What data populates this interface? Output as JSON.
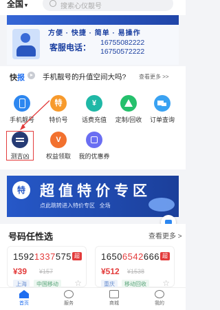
{
  "header": {
    "city": "全国",
    "search_placeholder": "搜索心仪靓号"
  },
  "banner": {
    "slogan": "方便 · 快捷 · 简单 · 易操作",
    "service_label": "客服电话：",
    "phones": [
      "16755082222",
      "16750572222"
    ]
  },
  "news": {
    "tag_prefix": "快",
    "tag_suffix": "报",
    "headline": "手机靓号的升值空间大吗?",
    "more": "查看更多 >>"
  },
  "grid": {
    "items": [
      {
        "label": "手机靓号",
        "icon": "phone-icon"
      },
      {
        "label": "特价号",
        "icon_text": "特"
      },
      {
        "label": "话费充值",
        "icon": "coin-icon"
      },
      {
        "label": "定制/回收",
        "icon": "triangle-icon"
      },
      {
        "label": "订单查询",
        "icon": "truck-icon"
      },
      {
        "label": "测吉凶",
        "icon": "lines-icon"
      },
      {
        "label": "权益领取",
        "icon_text": "V"
      },
      {
        "label": "我的优惠券",
        "icon": "bag-icon"
      }
    ]
  },
  "promo": {
    "badge": "特",
    "headline": "超值特价专区",
    "subline": "点此跳转进入特价专区",
    "tail": "全场"
  },
  "section": {
    "title": "号码任性选",
    "more": "查看更多 >"
  },
  "cards": [
    {
      "num_pre": "1592",
      "num_hi": "1337",
      "num_post": "575",
      "flag": "超",
      "price": "¥39",
      "old": "¥157",
      "chips": [
        "上海",
        "中国移动"
      ]
    },
    {
      "num_pre": "1650",
      "num_hi": "6542",
      "num_post": "666",
      "flag": "超",
      "price": "¥512",
      "old": "¥1538",
      "chips": [
        "重庆",
        "移动回收"
      ]
    }
  ],
  "tabbar": {
    "tabs": [
      "首页",
      "服务",
      "商城",
      "我的"
    ],
    "active": 0
  },
  "colors": {
    "accent": "#1f6ef0",
    "price": "#e33b3b",
    "highlight_box": "#e33b3b"
  }
}
